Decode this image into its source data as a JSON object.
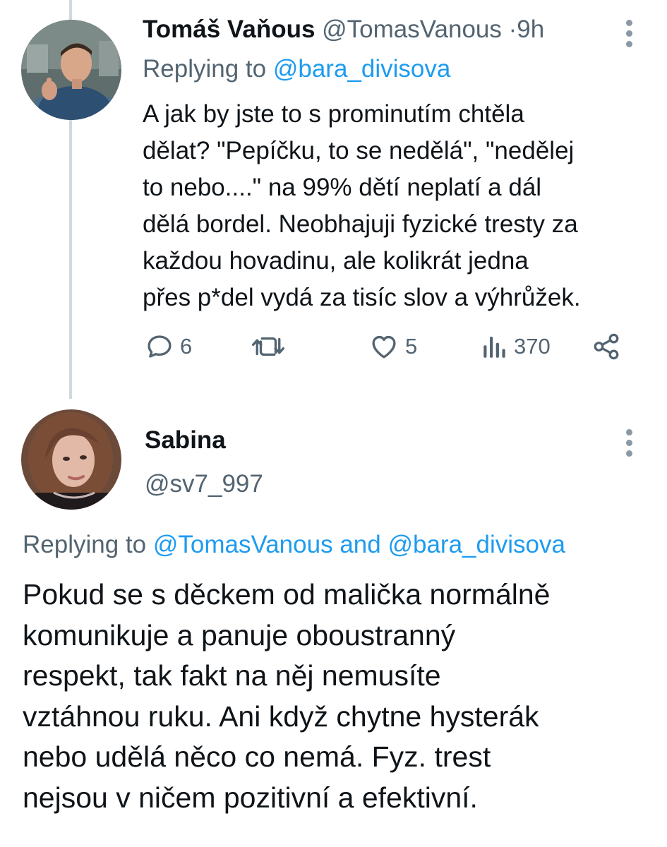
{
  "tweet1": {
    "display_name": "Tomáš Vaňous",
    "handle": "@TomasVanous",
    "separator": "·",
    "time": "9h",
    "replying_prefix": "Replying to",
    "replying_to": "@bara_divisova",
    "text": "A jak by jste to s prominutím chtěla\ndělat? \"Pepíčku, to se nedělá\", \"nedělej\nto nebo....\" na 99% dětí neplatí a dál\ndělá bordel. Neobhajuji fyzické tresty za\nkaždou hovadinu, ale kolikrát jedna\npřes p*del vydá za tisíc slov a výhrůžek.",
    "actions": {
      "replies": "6",
      "retweets": "",
      "likes": "5",
      "views": "370"
    },
    "avatar_icon": "avatar-man-thumbs-up"
  },
  "tweet2": {
    "display_name": "Sabina",
    "handle": "@sv7_997",
    "replying_prefix": "Replying to",
    "replying_to_1": "@TomasVanous",
    "replying_and": "and",
    "replying_to_2": "@bara_divisova",
    "text": "Pokud se s děckem od malička normálně\nkomunikuje a panuje oboustranný\nrespekt, tak fakt na něj nemusíte\nvztáhnou ruku. Ani když chytne hysterák\nnebo udělá něco co nemá. Fyz. trest\nnejsou v ničem pozitivní a efektivní.",
    "avatar_icon": "avatar-woman"
  },
  "colors": {
    "text": "#0f1419",
    "muted": "#536471",
    "link": "#1d9bf0",
    "thread_line": "#cfd9de"
  }
}
